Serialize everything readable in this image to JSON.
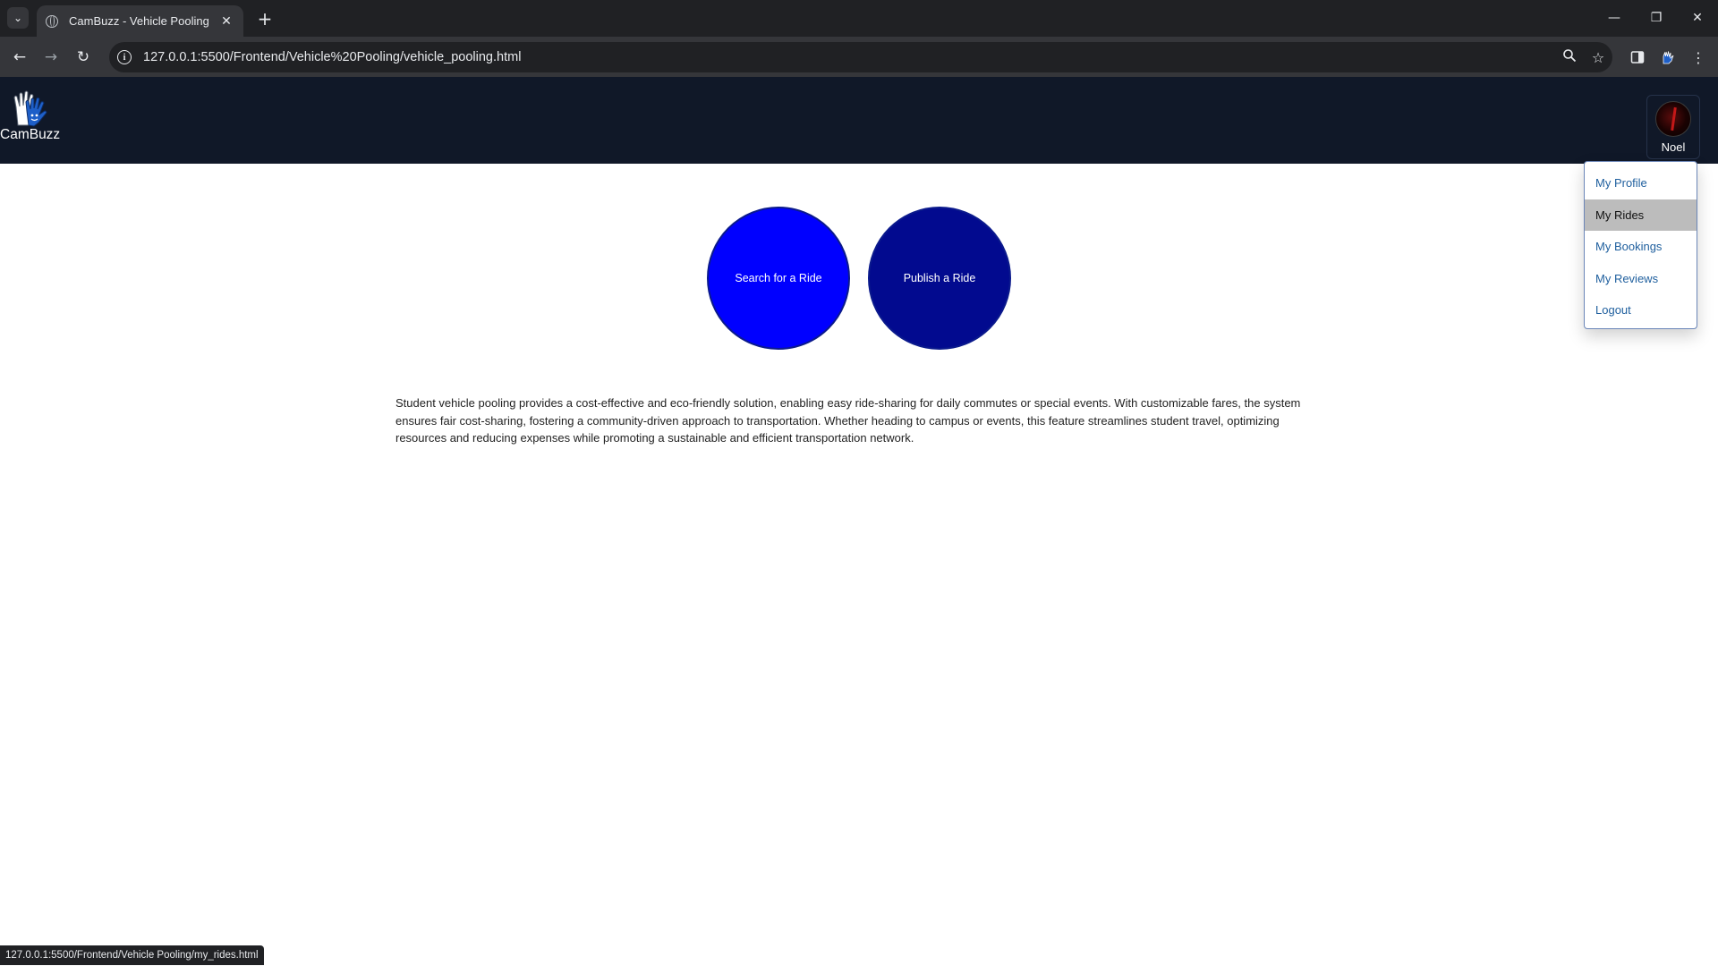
{
  "browser": {
    "tab_title": "CamBuzz - Vehicle Pooling",
    "url": "127.0.0.1:5500/Frontend/Vehicle%20Pooling/vehicle_pooling.html",
    "status_url": "127.0.0.1:5500/Frontend/Vehicle Pooling/my_rides.html",
    "icons": {
      "tab_search": "chevron-down-icon",
      "tab_close": "close-icon",
      "new_tab": "plus-icon",
      "back": "back-arrow-icon",
      "forward": "forward-arrow-icon",
      "reload": "reload-icon",
      "site_info": "info-icon",
      "zoom": "zoom-icon",
      "bookmark": "star-icon",
      "side_panel": "side-panel-icon",
      "extension": "extension-icon",
      "menu": "kebab-menu-icon"
    }
  },
  "header": {
    "logo_text": "CamBuzz",
    "user_name": "Noel"
  },
  "dropdown": {
    "items": [
      {
        "label": "My Profile"
      },
      {
        "label": "My Rides"
      },
      {
        "label": "My Bookings"
      },
      {
        "label": "My Reviews"
      },
      {
        "label": "Logout"
      }
    ],
    "hovered_item": "My Rides"
  },
  "actions": {
    "search_label": "Search for a Ride",
    "publish_label": "Publish a Ride"
  },
  "description": "Student vehicle pooling provides a cost-effective and eco-friendly solution, enabling easy ride-sharing for daily commutes or special events. With customizable fares, the system ensures fair cost-sharing, fostering a community-driven approach to transportation. Whether heading to campus or events, this feature streamlines student travel, optimizing resources and reducing expenses while promoting a sustainable and efficient transportation network.",
  "colors": {
    "header_bg": "#101828",
    "search_button": "#0000ff",
    "publish_button": "#020a8f",
    "link": "#1f5f9e",
    "hover_bg": "#bcbcbc"
  }
}
